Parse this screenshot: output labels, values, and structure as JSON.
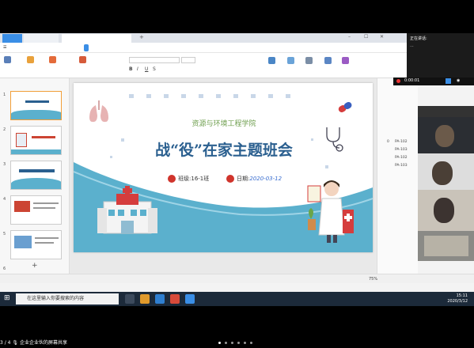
{
  "colors": {
    "accent": "#3a8ee6",
    "slide_title": "#2a5f8f",
    "slide_wave": "#5bb0cd",
    "subtitle": "#6f9f4f",
    "red_pin": "#d0342c",
    "date_blue": "#3a6ed0"
  },
  "tabs": {
    "home": "",
    "t2": "",
    "t3": ""
  },
  "menu": {
    "file": "",
    "start": "",
    "insert": "",
    "design": "",
    "switch": "",
    "animation": "",
    "slideshow": "",
    "review": "",
    "view": "",
    "security": "",
    "dev": "",
    "special": "",
    "smart": "",
    "search": ""
  },
  "ribbon": {
    "paste": "",
    "format": "",
    "from_current": "",
    "new_slide": "",
    "layout": "",
    "textbox": "",
    "shape": "",
    "arrange": "",
    "outline": "",
    "find": "",
    "replace": "",
    "select_pane": ""
  },
  "left_pane": {
    "tab_outline": "",
    "tab_slides": "",
    "slide_numbers": [
      "1",
      "2",
      "3",
      "4",
      "5",
      "6"
    ]
  },
  "slide": {
    "subtitle": "资源与环境工程学院",
    "title": "战“役”在家主题班会",
    "class_label": "班级:",
    "class_value": "16-1班",
    "date_label": "日期:",
    "date_value": "2020-03-12"
  },
  "notes": {
    "placeholder": ""
  },
  "right_pane": {
    "title": "",
    "select_window": "",
    "custom_anim": "",
    "modify": "",
    "order": "",
    "list_num": "0",
    "items": [
      "PA-102",
      "PA-103",
      "PA-102",
      "PA-103"
    ],
    "reorder": "",
    "auto_preview": "",
    "play": "",
    "show": ""
  },
  "status_bar": {
    "slide_count": "",
    "theme": "",
    "protect": "",
    "font_missing": "",
    "zoom": "75%"
  },
  "taskbar": {
    "search_placeholder": "在这里输入你要搜索的内容",
    "time": "15:11",
    "date": "2020/3/12"
  },
  "meeting": {
    "speaking_label": "正在讲话:",
    "timer": "0:00:01",
    "participants": [
      {
        "name": ""
      },
      {
        "name": ""
      },
      {
        "name": ""
      },
      {
        "name": ""
      },
      {
        "name": ""
      }
    ]
  },
  "share_status": {
    "count": "3 / 4",
    "text": "企业企业伙的屏幕共享"
  }
}
